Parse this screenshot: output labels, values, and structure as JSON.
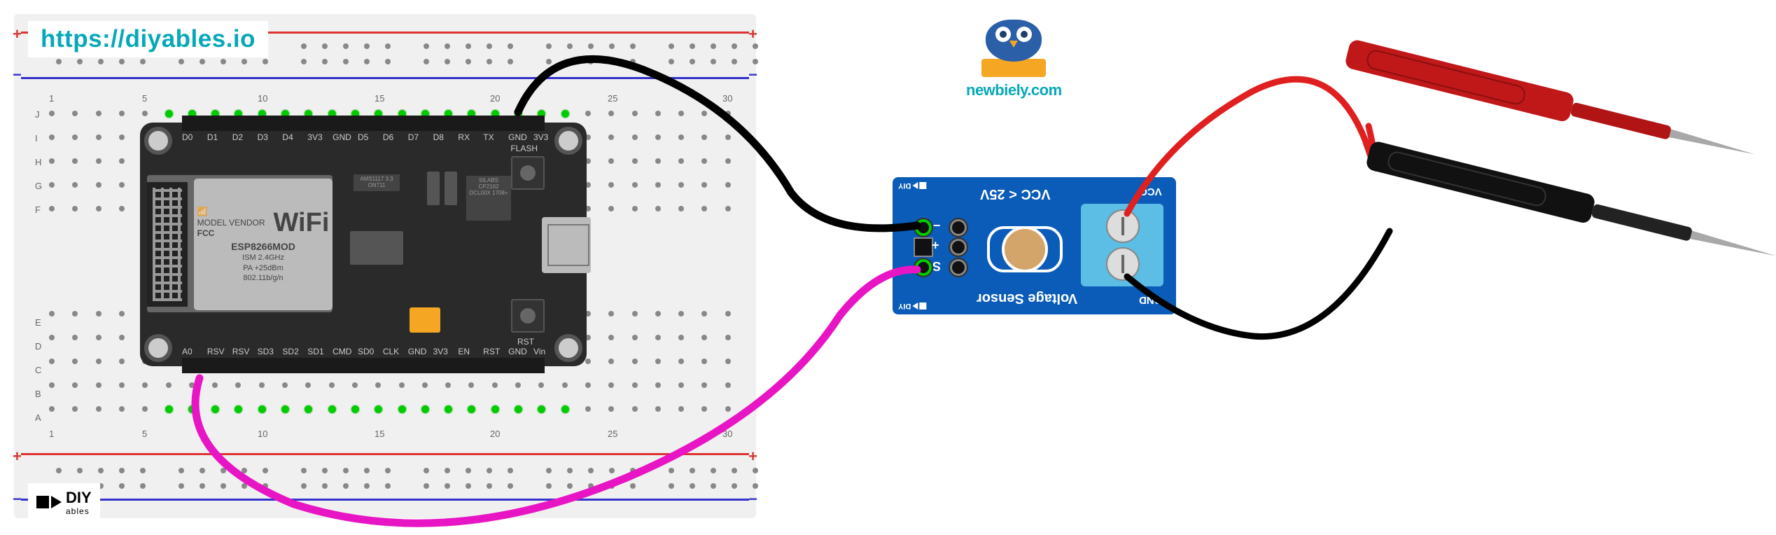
{
  "link_text": "https://diyables.io",
  "diy_brand": "DIY",
  "diy_sub": "ables",
  "newbiely": "newbiely.com",
  "esp8266": {
    "model": "ESP8266MOD",
    "vendor": "MODEL VENDOR",
    "fcc": "FCC",
    "specs": [
      "ISM 2.4GHz",
      "PA +25dBm",
      "802.11b/g/n"
    ],
    "wifi": "WiFi",
    "ams": "AMS1117\n3.3  ON711",
    "silabs": "SILABS\nCP2102\nDCL00X\n1708+",
    "btn_flash": "FLASH",
    "btn_rst": "RST",
    "pins_top": [
      "D0",
      "D1",
      "D2",
      "D3",
      "D4",
      "3V3",
      "GND",
      "D5",
      "D6",
      "D7",
      "D8",
      "RX",
      "TX",
      "GND",
      "3V3"
    ],
    "pins_bot": [
      "A0",
      "RSV",
      "RSV",
      "SD3",
      "SD2",
      "SD1",
      "CMD",
      "SD0",
      "CLK",
      "GND",
      "3V3",
      "EN",
      "RST",
      "GND",
      "Vin"
    ]
  },
  "voltage_sensor": {
    "title": "Voltage Sensor",
    "warn": "VCC < 25V",
    "term_vcc": "VCC",
    "term_gnd": "GND",
    "pin_s": "S",
    "pin_plus": "+",
    "pin_minus": "−"
  },
  "breadboard": {
    "rows_top": [
      "J",
      "I",
      "H",
      "G",
      "F"
    ],
    "rows_bot": [
      "E",
      "D",
      "C",
      "B",
      "A"
    ],
    "cols": [
      "1",
      "5",
      "10",
      "15",
      "20",
      "25",
      "30"
    ]
  }
}
